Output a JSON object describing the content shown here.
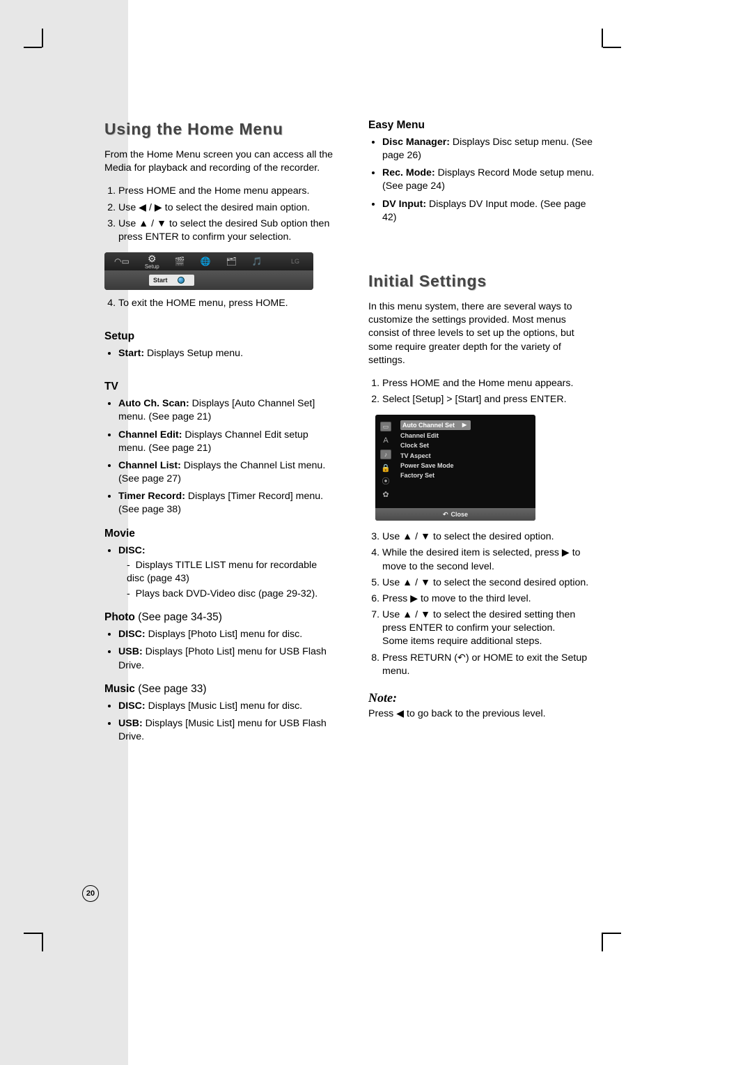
{
  "page_number": "20",
  "left": {
    "title": "Using the Home Menu",
    "intro": "From the Home Menu screen you can access all the Media for playback and recording of the recorder.",
    "steps_a": [
      "Press HOME and the Home menu appears.",
      "Use ◀ / ▶ to select the desired main option.",
      "Use ▲ / ▼ to select the desired Sub option then press ENTER to confirm your selection."
    ],
    "home_menu": {
      "setup_label": "Setup",
      "start_label": "Start",
      "brand": "LG"
    },
    "step4": "To exit the HOME menu, press HOME.",
    "setup": {
      "heading": "Setup",
      "items": [
        {
          "bold": "Start:",
          "text": " Displays Setup menu."
        }
      ]
    },
    "tv": {
      "heading": "TV",
      "items": [
        {
          "bold": "Auto Ch. Scan:",
          "text": " Displays [Auto Channel Set] menu. (See page 21)"
        },
        {
          "bold": "Channel Edit:",
          "text": " Displays Channel Edit setup menu. (See page 21)"
        },
        {
          "bold": "Channel List:",
          "text": " Displays the Channel List menu. (See page 27)"
        },
        {
          "bold": "Timer Record:",
          "text": " Displays [Timer Record] menu. (See page 38)"
        }
      ]
    },
    "movie": {
      "heading": "Movie",
      "disc_label": "DISC:",
      "disc_sub": [
        "Displays TITLE LIST menu for recordable disc (page 43)",
        "Plays back DVD-Video disc (page 29-32)."
      ]
    },
    "photo": {
      "heading": "Photo",
      "paren": " (See page 34-35)",
      "items": [
        {
          "bold": "DISC:",
          "text": " Displays [Photo List] menu for disc."
        },
        {
          "bold": "USB:",
          "text": " Displays [Photo List] menu for USB Flash Drive."
        }
      ]
    },
    "music": {
      "heading": "Music",
      "paren": " (See page 33)",
      "items": [
        {
          "bold": "DISC:",
          "text": " Displays [Music List] menu for disc."
        },
        {
          "bold": "USB:",
          "text": " Displays [Music List] menu for USB Flash Drive."
        }
      ]
    }
  },
  "right": {
    "easy": {
      "heading": "Easy Menu",
      "items": [
        {
          "bold": "Disc Manager:",
          "text": " Displays Disc setup menu. (See page 26)"
        },
        {
          "bold": "Rec. Mode:",
          "text": " Displays Record Mode setup menu. (See page 24)"
        },
        {
          "bold": "DV Input:",
          "text": " Displays DV Input mode. (See page 42)"
        }
      ]
    },
    "initial": {
      "title": "Initial Settings",
      "intro": "In this menu system, there are several ways to customize the settings provided. Most menus consist of three levels to set up the options, but some require greater depth for the variety of settings.",
      "steps_a": [
        "Press HOME and the Home menu appears.",
        "Select [Setup] > [Start] and press ENTER."
      ],
      "menu": {
        "options": [
          "Auto Channel Set",
          "Channel Edit",
          "Clock Set",
          "TV Aspect",
          "Power Save Mode",
          "Factory Set"
        ],
        "close": "Close"
      },
      "steps_b": [
        "Use ▲ / ▼ to select the desired option.",
        "While the desired item is selected, press ▶ to move to the second level.",
        "Use ▲ / ▼ to select the second desired option.",
        "Press ▶ to move to the third level.",
        "Use ▲ / ▼ to select the desired setting then press ENTER to confirm your selection.\nSome items require additional steps.",
        "Press RETURN (↶) or HOME to exit the Setup menu."
      ],
      "note_head": "Note:",
      "note_body": "Press ◀ to go back to the previous level."
    }
  }
}
